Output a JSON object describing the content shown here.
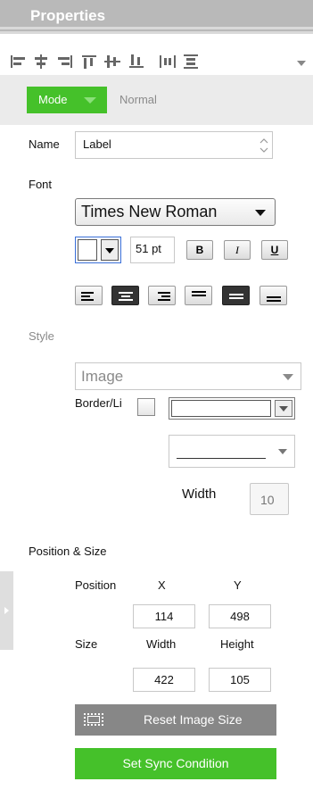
{
  "panel": {
    "title": "Properties"
  },
  "align_toolbar": {
    "icons": [
      "align-left-icon",
      "align-center-icon",
      "align-right-icon",
      "align-top-icon",
      "align-middle-icon",
      "align-bottom-icon",
      "distribute-horizontal-icon",
      "distribute-vertical-icon"
    ],
    "overflow_icon": "chevron-down-icon"
  },
  "mode": {
    "button_label": "Mode",
    "value": "Normal",
    "accent": "#45c12a"
  },
  "name": {
    "label": "Name",
    "value": "Label"
  },
  "font": {
    "section_label": "Font",
    "family": "Times New Roman",
    "size": "51 pt",
    "bold_label": "B",
    "italic_label": "I",
    "underline_label": "U",
    "color": "#ffffff",
    "alignment_icons": [
      "align-text-left-icon",
      "align-text-center-icon",
      "align-text-right-icon",
      "valign-top-icon",
      "valign-middle-icon",
      "valign-bottom-icon"
    ]
  },
  "style": {
    "section_label": "Style",
    "fill_type": "Image",
    "border_label": "Border/Li",
    "border_checked": false,
    "border_color": "#ffffff",
    "width_label": "Width",
    "width_value": "10"
  },
  "position_size": {
    "section_label": "Position & Size",
    "position_label": "Position",
    "x_label": "X",
    "y_label": "Y",
    "x_value": "114",
    "y_value": "498",
    "size_label": "Size",
    "width_label": "Width",
    "height_label": "Height",
    "width_value": "422",
    "height_value": "105"
  },
  "actions": {
    "reset_label": "Reset Image Size",
    "sync_label": "Set Sync Condition",
    "sync_color": "#45c12a",
    "reset_color": "#878787"
  }
}
